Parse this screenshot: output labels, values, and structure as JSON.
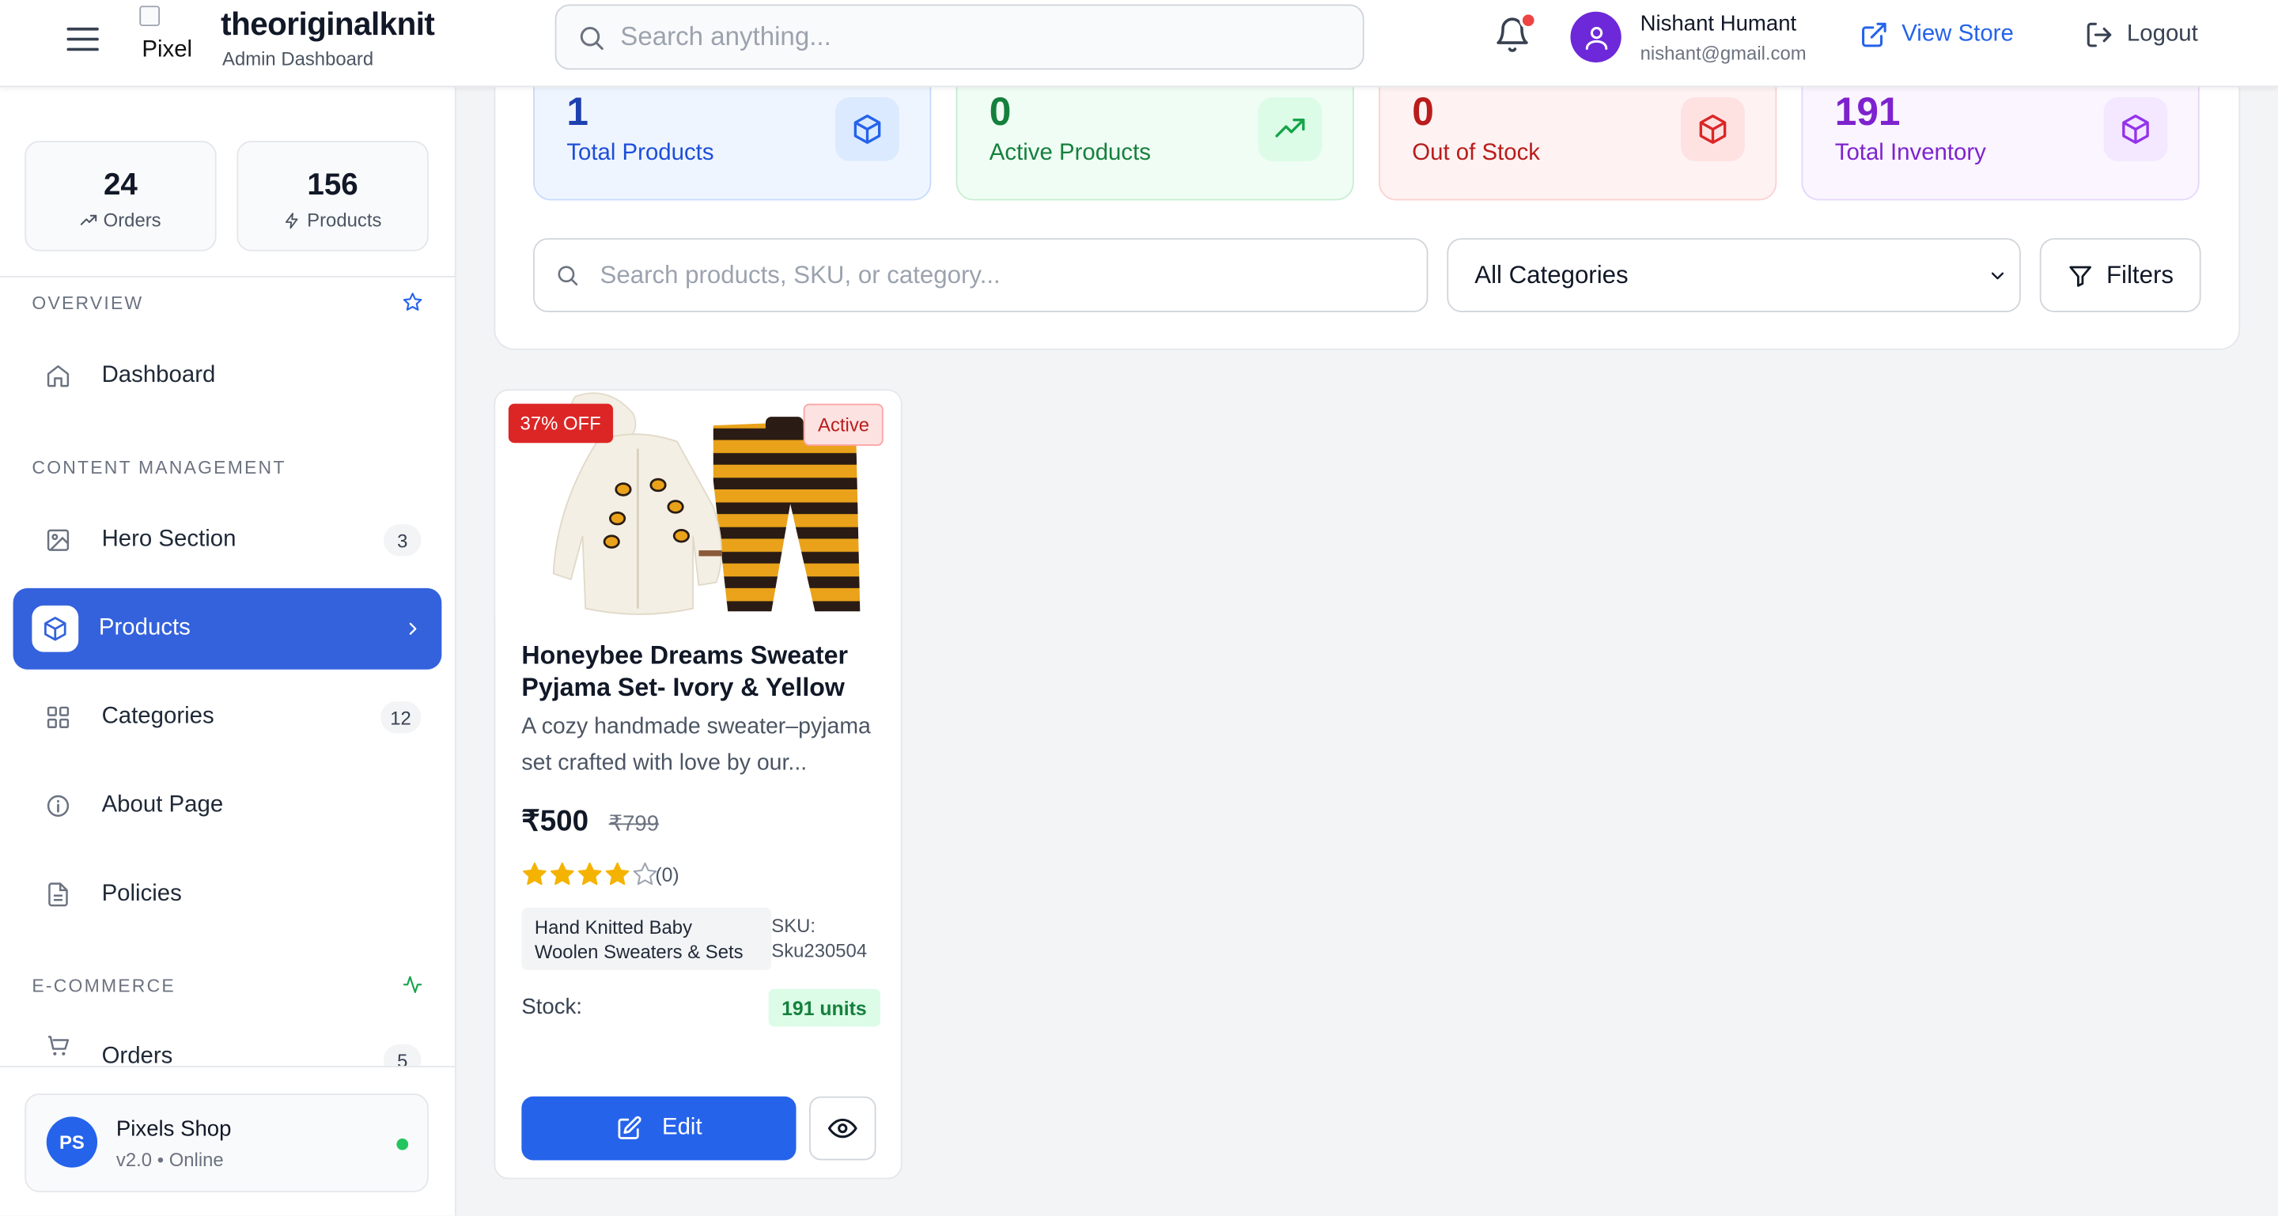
{
  "header": {
    "logo_alt": "Pixel",
    "brand_name": "theoriginalknit",
    "brand_subtitle": "Admin Dashboard",
    "search_placeholder": "Search anything...",
    "user_name": "Nishant Humant",
    "user_email": "nishant@gmail.com",
    "view_store_label": "View Store",
    "logout_label": "Logout"
  },
  "sidebar": {
    "stats": [
      {
        "value": "24",
        "label": "Orders",
        "icon": "trending-up-icon"
      },
      {
        "value": "156",
        "label": "Products",
        "icon": "zap-icon"
      }
    ],
    "sections": {
      "overview": "OVERVIEW",
      "content_management": "CONTENT MANAGEMENT",
      "ecommerce": "E-COMMERCE"
    },
    "items": [
      {
        "label": "Dashboard",
        "icon": "home-icon"
      },
      {
        "label": "Hero Section",
        "badge": "3",
        "icon": "image-icon"
      },
      {
        "label": "Products",
        "icon": "box-icon",
        "active": true
      },
      {
        "label": "Categories",
        "badge": "12",
        "icon": "grid-icon"
      },
      {
        "label": "About Page",
        "icon": "info-icon"
      },
      {
        "label": "Policies",
        "icon": "file-icon"
      },
      {
        "label": "Orders",
        "badge": "5",
        "icon": "cart-icon"
      }
    ],
    "shop": {
      "initials": "PS",
      "name": "Pixels Shop",
      "version": "v2.0 • Online"
    }
  },
  "stats_cards": [
    {
      "value": "1",
      "label": "Total Products",
      "color": "#1e40af",
      "icon": "box-icon"
    },
    {
      "value": "0",
      "label": "Active Products",
      "color": "#15803d",
      "icon": "trending-up-icon"
    },
    {
      "value": "0",
      "label": "Out of Stock",
      "color": "#b91c1c",
      "icon": "box-icon"
    },
    {
      "value": "191",
      "label": "Total Inventory",
      "color": "#7e22ce",
      "icon": "box-icon"
    }
  ],
  "filters": {
    "search_placeholder": "Search products, SKU, or category...",
    "category_selected": "All Categories",
    "filters_label": "Filters"
  },
  "products": [
    {
      "discount_badge": "37% OFF",
      "status": "Active",
      "title": "Honeybee Dreams Sweater Pyjama Set- Ivory & Yellow",
      "description": "A cozy handmade sweater–pyjama set crafted with love by our...",
      "price": "₹500",
      "mrp": "₹799",
      "rating": 4,
      "rating_count": "(0)",
      "category": "Hand Knitted Baby Woolen Sweaters & Sets",
      "sku_label": "SKU:",
      "sku": "Sku230504",
      "stock_label": "Stock:",
      "stock": "191 units",
      "edit_label": "Edit"
    }
  ],
  "colors": {
    "accent": "#3462dd",
    "button": "#2563eb",
    "danger": "#dc2626",
    "success": "#22c55e",
    "star": "#f5b301"
  }
}
